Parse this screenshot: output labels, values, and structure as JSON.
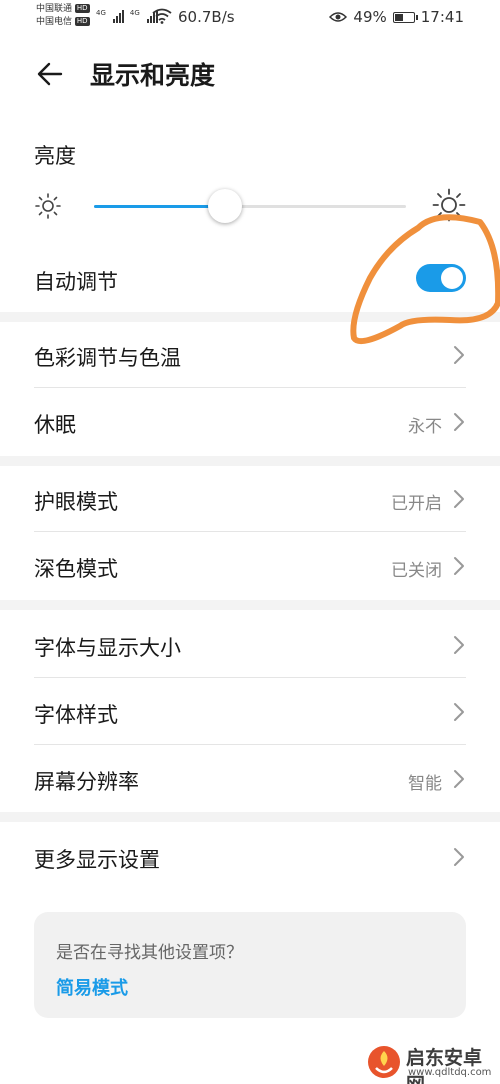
{
  "status_bar": {
    "carrier1": "中国联通",
    "carrier2": "中国电信",
    "hd_badge": "HD",
    "network": "4G",
    "speed": "60.7B/s",
    "battery": "49%",
    "battery_level": 0.49,
    "time": "17:41",
    "icons": [
      "signal-icon",
      "wifi-icon",
      "eye-icon",
      "battery-icon"
    ]
  },
  "header": {
    "title": "显示和亮度",
    "back_icon": "arrow-left-icon"
  },
  "brightness": {
    "label": "亮度",
    "level": 0.42,
    "auto_label": "自动调节",
    "auto_enabled": true
  },
  "groups": [
    [
      {
        "label": "色彩调节与色温",
        "value": ""
      },
      {
        "label": "休眠",
        "value": "永不"
      }
    ],
    [
      {
        "label": "护眼模式",
        "value": "已开启"
      },
      {
        "label": "深色模式",
        "value": "已关闭"
      }
    ],
    [
      {
        "label": "字体与显示大小",
        "value": ""
      },
      {
        "label": "字体样式",
        "value": ""
      },
      {
        "label": "屏幕分辨率",
        "value": "智能"
      }
    ],
    [
      {
        "label": "更多显示设置",
        "value": ""
      }
    ]
  ],
  "suggestion": {
    "question": "是否在寻找其他设置项？",
    "link": "简易模式"
  },
  "watermark": {
    "name": "启东安卓网",
    "url": "www.qdltdq.com"
  },
  "colors": {
    "accent": "#1a9be8",
    "annotation": "#f0903c",
    "section_gap": "#f3f3f3"
  }
}
